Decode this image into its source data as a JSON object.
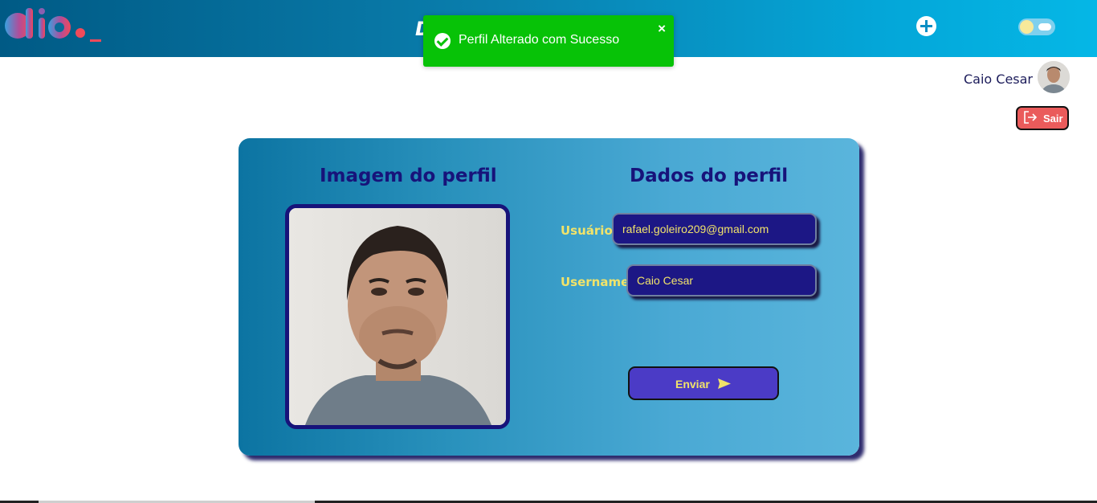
{
  "header": {
    "title": "D",
    "logo_text": "dio._",
    "add_icon": "plus-circle-icon",
    "theme_toggle_icon": "sun-cloud-toggle-icon"
  },
  "toast": {
    "message": "Perfil Alterado com Sucesso",
    "close_label": "×",
    "status_color": "#07c207",
    "icon": "check-circle-icon"
  },
  "user": {
    "name": "Caio Cesar",
    "logout_label": "Sair",
    "logout_icon": "logout-icon"
  },
  "profile": {
    "image_section_title": "Imagem do perfil",
    "data_section_title": "Dados do perfil",
    "fields": [
      {
        "label": "Usuário:",
        "value": "rafael.goleiro209@gmail.com"
      },
      {
        "label": "Username:",
        "value": "Caio Cesar"
      }
    ],
    "submit_label": "Enviar",
    "submit_icon": "send-icon"
  },
  "colors": {
    "accent_dark": "#17137a",
    "label_yellow": "#f1e36a",
    "logout_red": "#ea5b5b"
  }
}
